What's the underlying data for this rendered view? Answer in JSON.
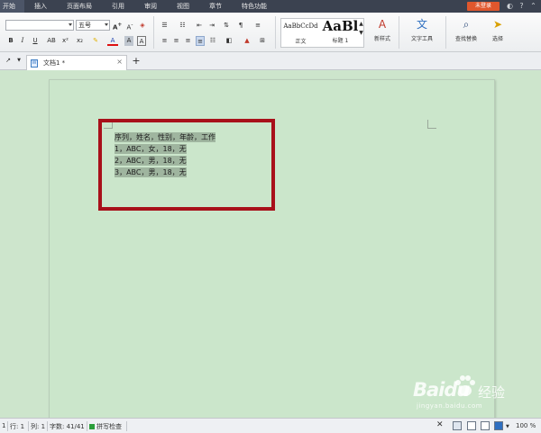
{
  "menu": {
    "tabs": [
      "开始",
      "插入",
      "页面布局",
      "引用",
      "审阅",
      "视图",
      "章节",
      "特色功能"
    ],
    "login_label": "未登录"
  },
  "ribbon": {
    "font_size_value": "五号",
    "styles": [
      {
        "sample": "AaBbCcDd",
        "label": "正文"
      },
      {
        "sample": "AaBl",
        "label": "标题 1"
      }
    ],
    "new_style_label": "新样式",
    "text_tools_label": "文字工具",
    "find_replace_label": "查找替换",
    "select_label": "选择",
    "icons": [
      "bold-icon",
      "italic-icon",
      "underline-icon",
      "superscript-icon",
      "subscript-icon",
      "highlight-icon",
      "font-color-icon",
      "char-shading-icon",
      "clear-format-icon",
      "bullets-icon",
      "numbering-icon",
      "indent-icon",
      "align-left-icon",
      "align-center-icon",
      "align-right-icon",
      "justify-icon",
      "distribute-icon",
      "line-spacing-icon",
      "paragraph-shading-icon",
      "borders-icon"
    ]
  },
  "tabstrip": {
    "doc_name": "文档1 *",
    "add_label": "+"
  },
  "document": {
    "lines": [
      "序列，姓名，性别，年龄，工作",
      "1，ABC，女，18，无",
      "2，ABC，男，18，无",
      "3，ABC，男，18，无"
    ]
  },
  "watermark": {
    "brand": "Baidu",
    "label": "经验",
    "url": "jingyan.baidu.com"
  },
  "statusbar": {
    "page": "1",
    "row": "行: 1",
    "col": "列: 1",
    "word_count": "字数: 41/41",
    "spell_check": "拼写检查",
    "zoom": "100 %"
  }
}
